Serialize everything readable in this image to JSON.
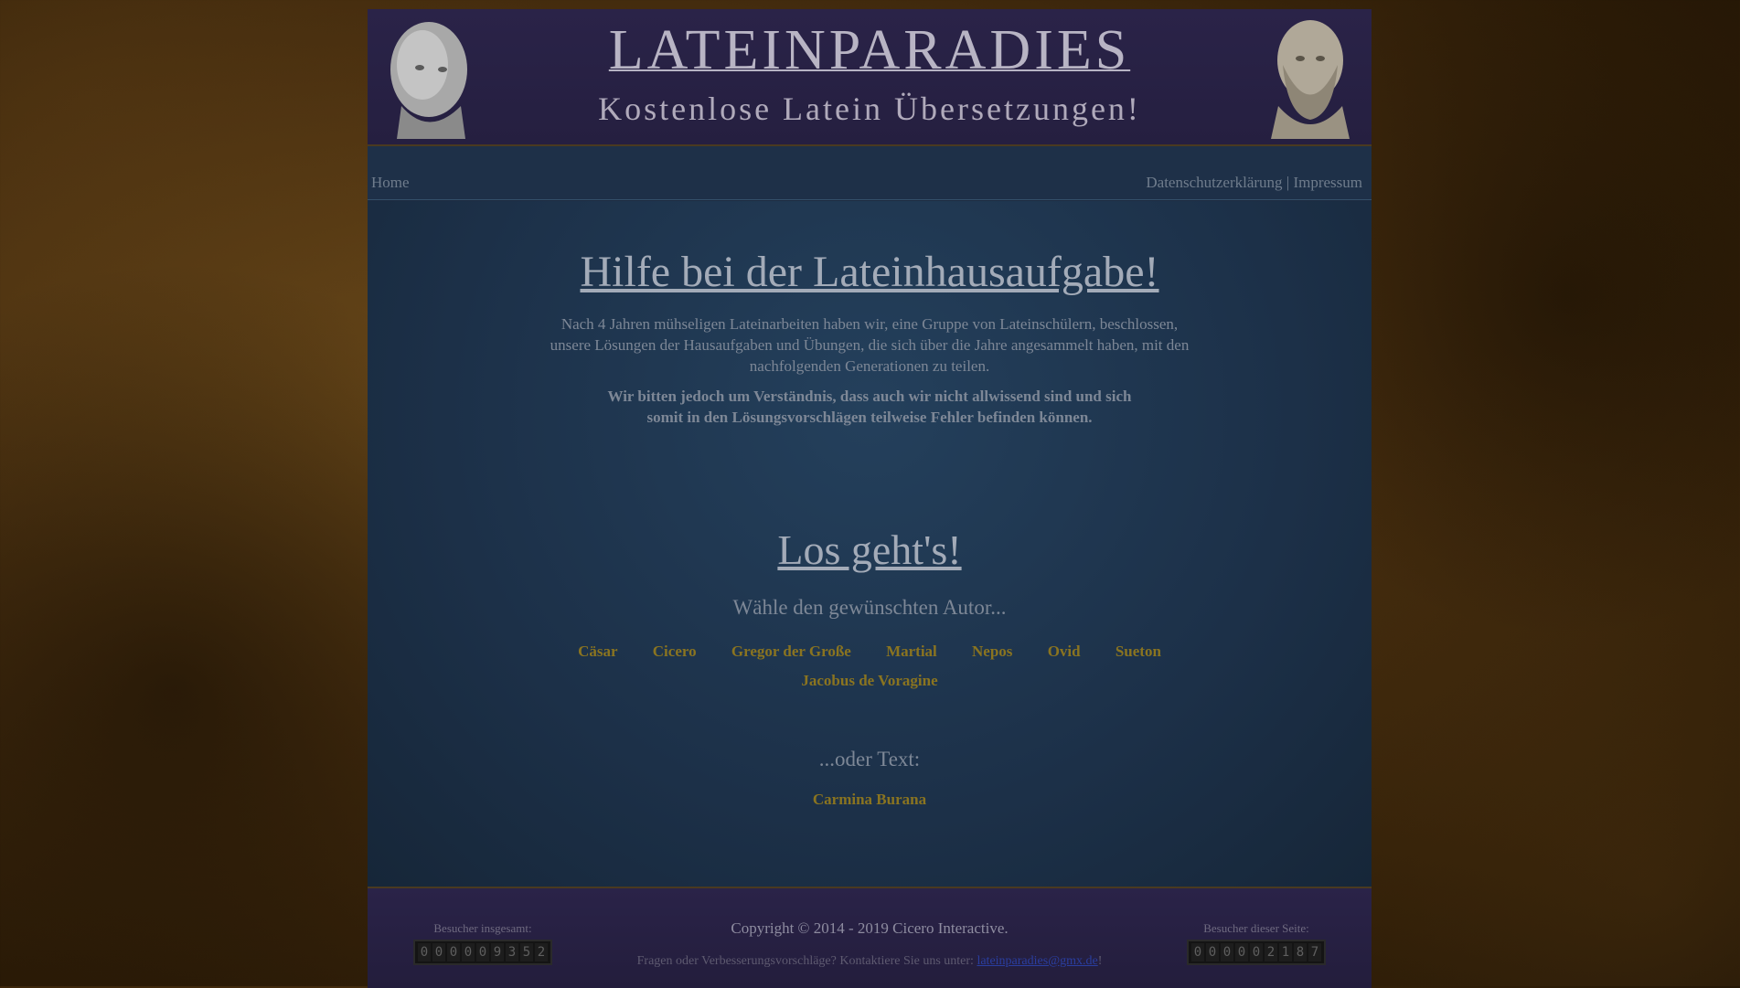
{
  "header": {
    "title": "LATEINPARADIES",
    "subtitle": "Kostenlose Latein Übersetzungen!"
  },
  "nav": {
    "home": "Home",
    "privacy": "Datenschutzerklärung",
    "separator": "|",
    "imprint": "Impressum"
  },
  "main": {
    "heading": "Hilfe bei der Lateinhausaufgabe!",
    "intro": "Nach 4 Jahren mühseligen Lateinarbeiten haben wir, eine Gruppe von Lateinschülern, beschlossen, unsere Lösungen der Hausaufgaben und Übungen, die sich über die Jahre angesammelt haben, mit den nachfolgenden Generationen zu teilen.",
    "note": "Wir bitten jedoch um Verständnis, dass auch wir nicht allwissend sind und sich somit in den Lösungsvorschlägen teilweise Fehler befinden können.",
    "start_heading": "Los geht's!",
    "choose_author": "Wähle den gewünschten Autor...",
    "authors": [
      "Cäsar",
      "Cicero",
      "Gregor der Große",
      "Martial",
      "Nepos",
      "Ovid",
      "Sueton",
      "Jacobus de Voragine"
    ],
    "or_text": "...oder Text:",
    "texts": [
      "Carmina Burana"
    ]
  },
  "footer": {
    "visitors_total_label": "Besucher insgesamt:",
    "visitors_total_digits": [
      "0",
      "0",
      "0",
      "0",
      "0",
      "9",
      "3",
      "5",
      "2"
    ],
    "copyright": "Copyright © 2014 - 2019 Cicero Interactive.",
    "contact_text": "Fragen oder Verbesserungsvorschläge? Kontaktiere Sie uns unter:",
    "contact_email": "lateinparadies@gmx.de",
    "contact_end": "!",
    "visitors_page_label": "Besucher dieser Seite:",
    "visitors_page_digits": [
      "0",
      "0",
      "0",
      "0",
      "0",
      "2",
      "1",
      "8",
      "7"
    ]
  }
}
